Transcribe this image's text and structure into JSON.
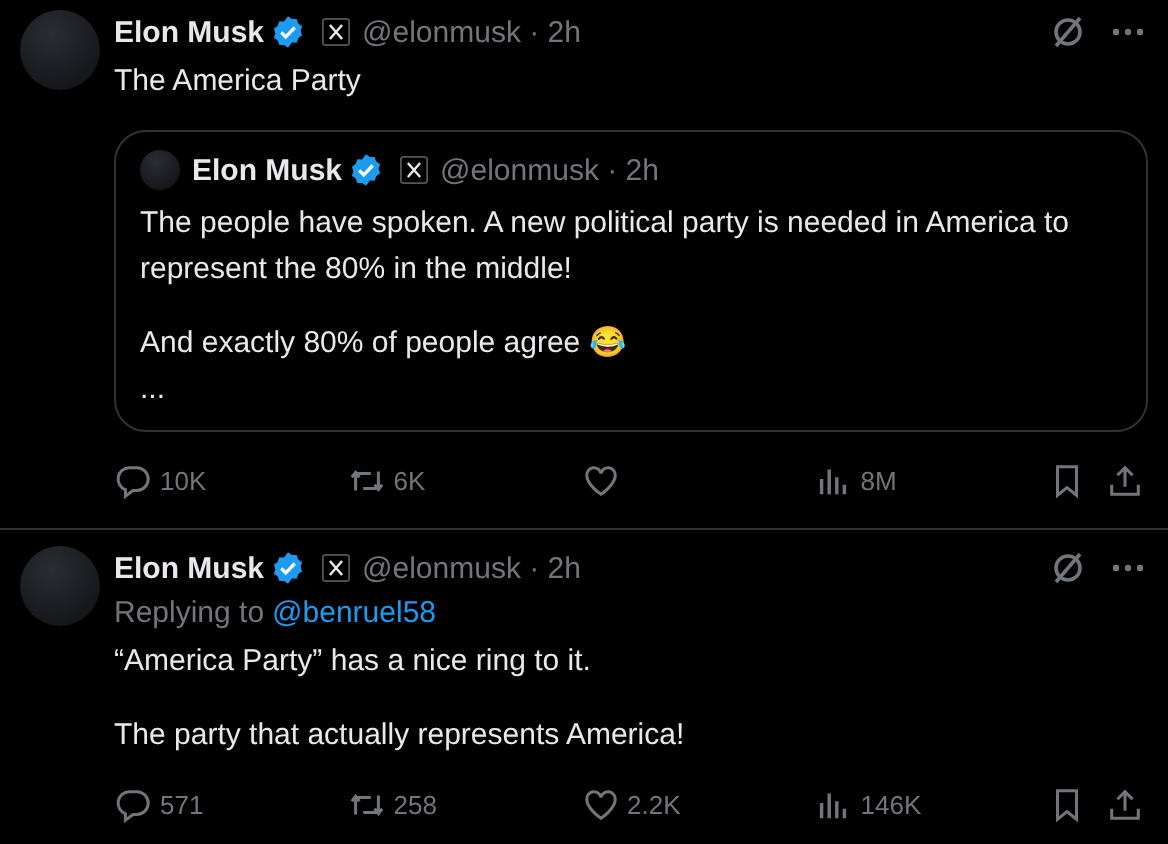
{
  "tweets": [
    {
      "author": "Elon Musk",
      "verified": true,
      "handle": "@elonmusk",
      "separator": "·",
      "time": "2h",
      "paragraphs": [
        "The America Party"
      ],
      "quote": {
        "author": "Elon Musk",
        "verified": true,
        "handle": "@elonmusk",
        "separator": "·",
        "time": "2h",
        "paragraphs": [
          "The people have spoken. A new political party is needed in America to represent the 80% in the middle!",
          "And exactly 80% of people agree 😂",
          "..."
        ]
      },
      "actions": {
        "replies": "10K",
        "reposts": "6K",
        "views": "8M"
      }
    },
    {
      "author": "Elon Musk",
      "verified": true,
      "handle": "@elonmusk",
      "separator": "·",
      "time": "2h",
      "replying_to": {
        "label": "Replying to",
        "user": "@benruel58"
      },
      "paragraphs": [
        "“America Party” has a nice ring to it.",
        "The party that actually represents America!"
      ],
      "actions": {
        "replies": "571",
        "reposts": "258",
        "likes": "2.2K",
        "views": "146K"
      }
    }
  ]
}
